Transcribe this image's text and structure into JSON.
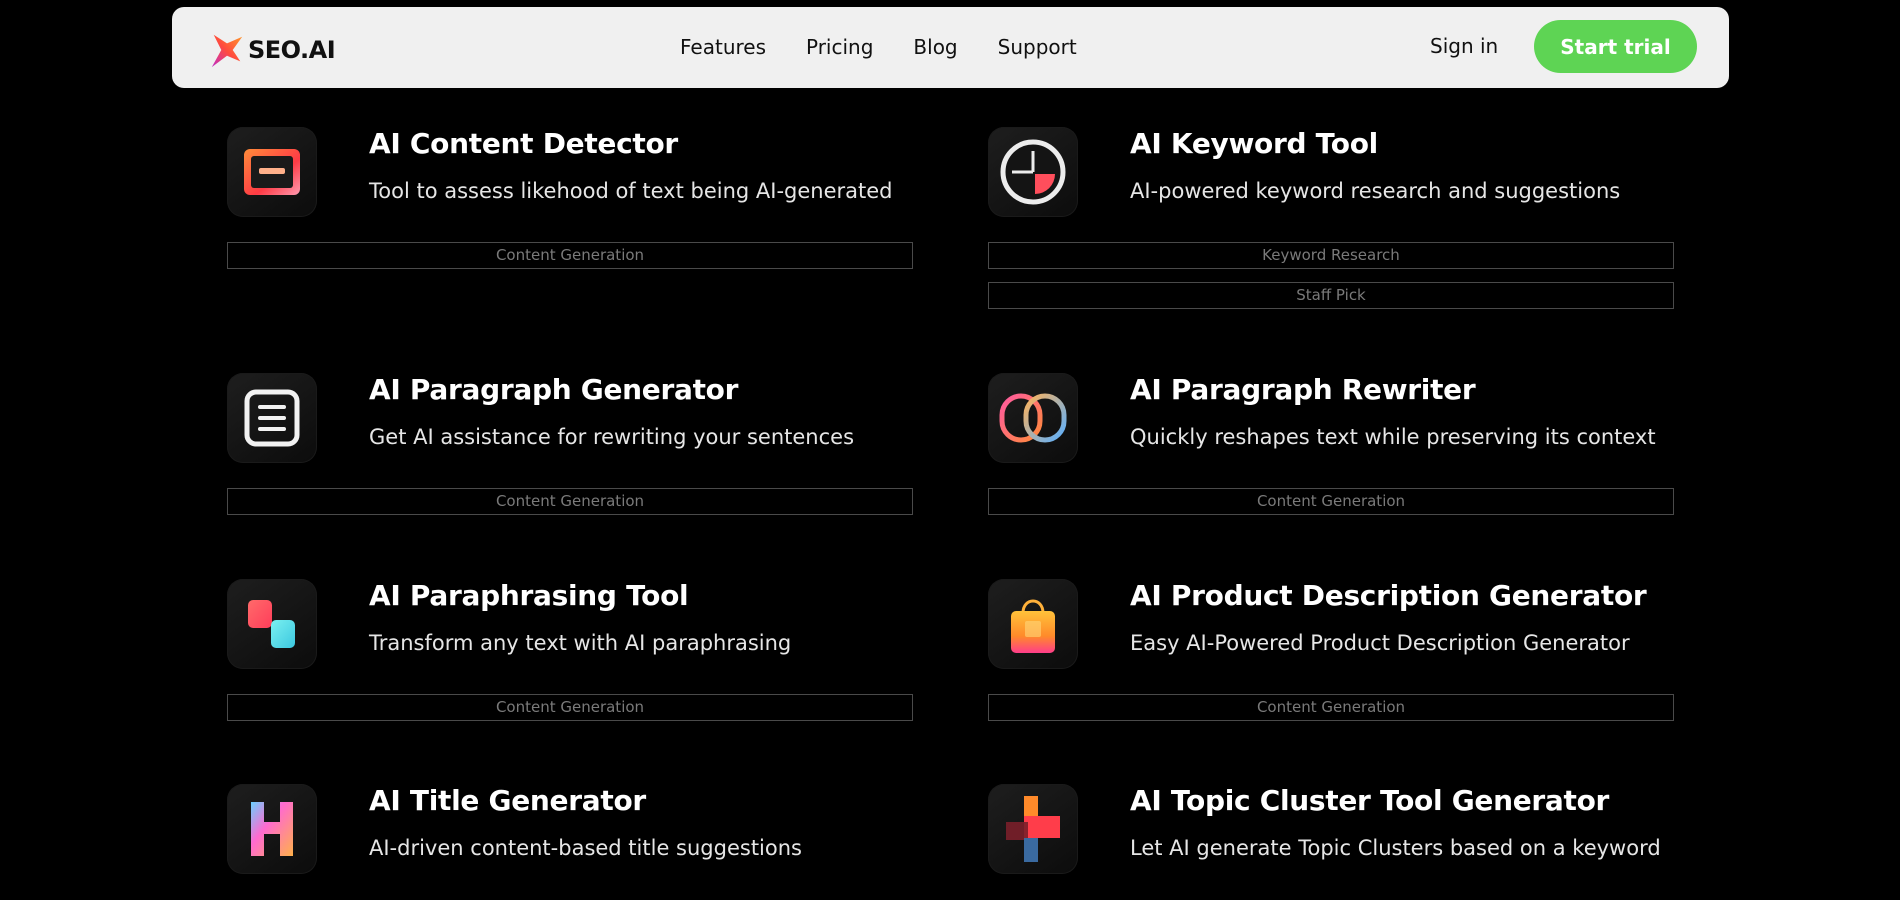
{
  "nav": {
    "logo_text": "SEO.AI",
    "links": [
      "Features",
      "Pricing",
      "Blog",
      "Support"
    ],
    "sign_in": "Sign in",
    "cta": "Start trial",
    "cta_color": "#5ed454"
  },
  "tools": [
    {
      "title": "AI Content Detector",
      "desc": "Tool to assess likehood of text being AI-generated",
      "icon": "content-detector-icon",
      "tags": [
        "Content Generation"
      ]
    },
    {
      "title": "AI Keyword Tool",
      "desc": "AI-powered keyword research and suggestions",
      "icon": "keyword-pie-icon",
      "tags": [
        "Keyword Research",
        "Staff Pick"
      ]
    },
    {
      "title": "AI Paragraph Generator",
      "desc": "Get AI assistance for rewriting your sentences",
      "icon": "paragraph-document-icon",
      "tags": [
        "Content Generation"
      ]
    },
    {
      "title": "AI Paragraph Rewriter",
      "desc": "Quickly reshapes text while preserving its context",
      "icon": "interlocking-rings-icon",
      "tags": [
        "Content Generation"
      ]
    },
    {
      "title": "AI Paraphrasing Tool",
      "desc": "Transform any text with AI paraphrasing",
      "icon": "paraphrase-squares-icon",
      "tags": [
        "Content Generation"
      ]
    },
    {
      "title": "AI Product Description Generator",
      "desc": "Easy AI-Powered Product Description Generator",
      "icon": "shopping-bag-icon",
      "tags": [
        "Content Generation"
      ]
    },
    {
      "title": "AI Title Generator",
      "desc": "AI-driven content-based title suggestions",
      "icon": "letter-h-icon",
      "tags": []
    },
    {
      "title": "AI Topic Cluster Tool Generator",
      "desc": "Let AI generate Topic Clusters based on a keyword",
      "icon": "topic-cluster-icon",
      "tags": []
    }
  ]
}
